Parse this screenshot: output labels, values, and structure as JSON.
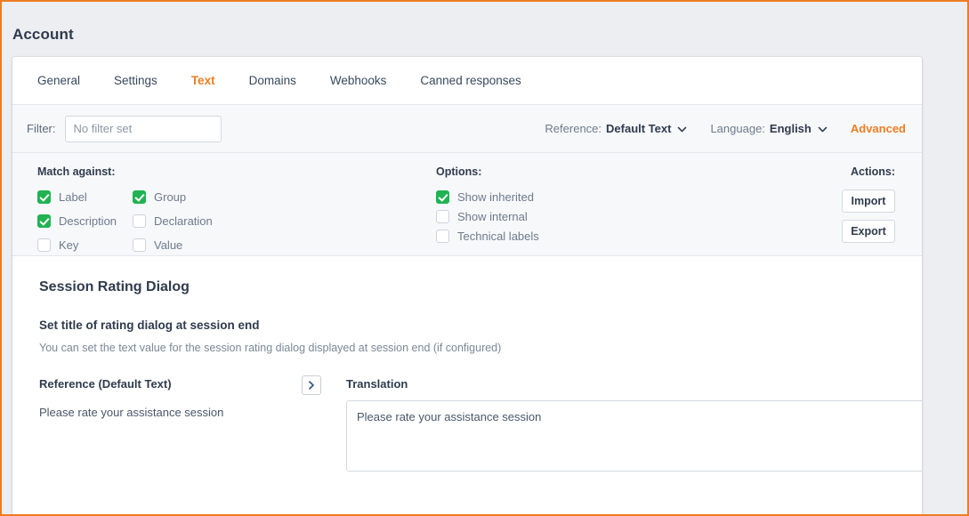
{
  "page": {
    "title": "Account"
  },
  "tabs": [
    {
      "label": "General",
      "active": false
    },
    {
      "label": "Settings",
      "active": false
    },
    {
      "label": "Text",
      "active": true
    },
    {
      "label": "Domains",
      "active": false
    },
    {
      "label": "Webhooks",
      "active": false
    },
    {
      "label": "Canned responses",
      "active": false
    }
  ],
  "filterbar": {
    "filter_label": "Filter:",
    "filter_value": "",
    "filter_placeholder": "No filter set",
    "reference_prefix": "Reference:",
    "reference_value": "Default Text",
    "language_prefix": "Language:",
    "language_value": "English",
    "advanced_label": "Advanced"
  },
  "options_panel": {
    "match_title": "Match against:",
    "match_items": [
      {
        "label": "Label",
        "checked": true
      },
      {
        "label": "Group",
        "checked": true
      },
      {
        "label": "Description",
        "checked": true
      },
      {
        "label": "Declaration",
        "checked": false
      },
      {
        "label": "Key",
        "checked": false
      },
      {
        "label": "Value",
        "checked": false
      }
    ],
    "options_title": "Options:",
    "options_items": [
      {
        "label": "Show inherited",
        "checked": true
      },
      {
        "label": "Show internal",
        "checked": false
      },
      {
        "label": "Technical labels",
        "checked": false
      }
    ],
    "actions_title": "Actions:",
    "import_label": "Import",
    "export_label": "Export"
  },
  "content": {
    "section_title": "Session Rating Dialog",
    "entry_title": "Set title of rating dialog at session end",
    "entry_desc": "You can set the text value for the session rating dialog displayed at session end (if configured)",
    "reference_head": "Reference (Default Text)",
    "reference_value": "Please rate your assistance session",
    "translation_head": "Translation",
    "translation_value": "Please rate your assistance session",
    "translation_placeholder": ""
  },
  "colors": {
    "accent_orange": "#ef7c22",
    "checkbox_green": "#1fb352",
    "text_dark": "#2f3b4d",
    "text_muted": "#7b8897",
    "panel_bg": "#f7f8fa",
    "page_bg": "#eceef1"
  }
}
